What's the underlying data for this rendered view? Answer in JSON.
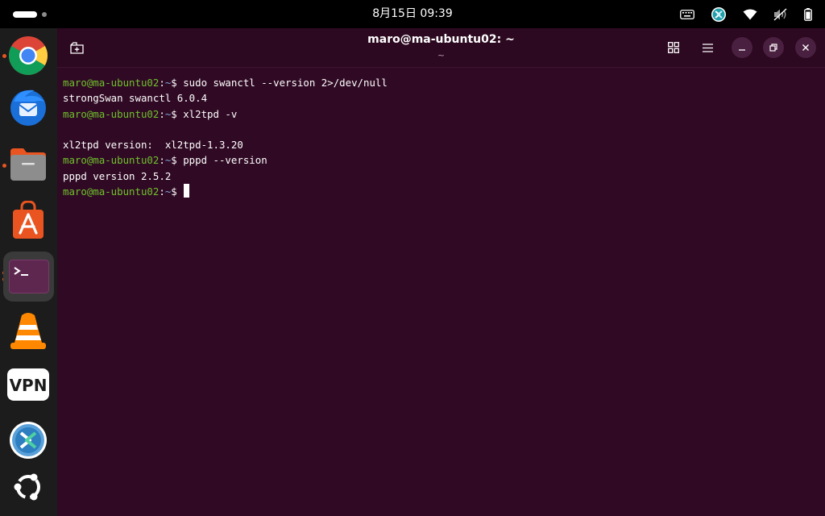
{
  "topbar": {
    "clock": "8月15日  09:39",
    "tray_icons": [
      "keyboard-icon",
      "remote-desktop-icon",
      "wifi-icon",
      "volume-muted-icon",
      "battery-icon"
    ]
  },
  "dock": {
    "apps": [
      {
        "name": "Google Chrome",
        "icon": "chrome-icon",
        "running": true
      },
      {
        "name": "Thunderbird",
        "icon": "thunderbird-icon",
        "running": false
      },
      {
        "name": "Files",
        "icon": "files-icon",
        "running": true
      },
      {
        "name": "App Center",
        "icon": "app-center-icon",
        "running": false
      },
      {
        "name": "Terminal",
        "icon": "terminal-icon",
        "running": true,
        "active": true
      },
      {
        "name": "VLC",
        "icon": "vlc-icon",
        "running": false
      },
      {
        "name": "VPN",
        "icon": "vpn-icon",
        "running": false,
        "label": "VPN"
      },
      {
        "name": "Remote Desktop",
        "icon": "remote-desktop-app-icon",
        "running": false
      },
      {
        "name": "Show Apps",
        "icon": "ubuntu-logo-icon",
        "running": false
      }
    ]
  },
  "window": {
    "title": "maro@ma-ubuntu02: ~",
    "subtitle": "~",
    "colors": {
      "background": "#300a24",
      "prompt_user": "#6fc12d",
      "prompt_path": "#7aa6da"
    }
  },
  "terminal": {
    "prompt": {
      "user_host": "maro@ma-ubuntu02",
      "sep": ":",
      "path": "~",
      "symbol": "$ "
    },
    "lines": [
      {
        "type": "cmd",
        "text": "sudo swanctl --version 2>/dev/null"
      },
      {
        "type": "out",
        "text": "strongSwan swanctl 6.0.4"
      },
      {
        "type": "cmd",
        "text": "xl2tpd -v"
      },
      {
        "type": "out",
        "text": ""
      },
      {
        "type": "out",
        "text": "xl2tpd version:  xl2tpd-1.3.20"
      },
      {
        "type": "cmd",
        "text": "pppd --version"
      },
      {
        "type": "out",
        "text": "pppd version 2.5.2"
      },
      {
        "type": "cmd",
        "text": "",
        "cursor": true
      }
    ]
  }
}
